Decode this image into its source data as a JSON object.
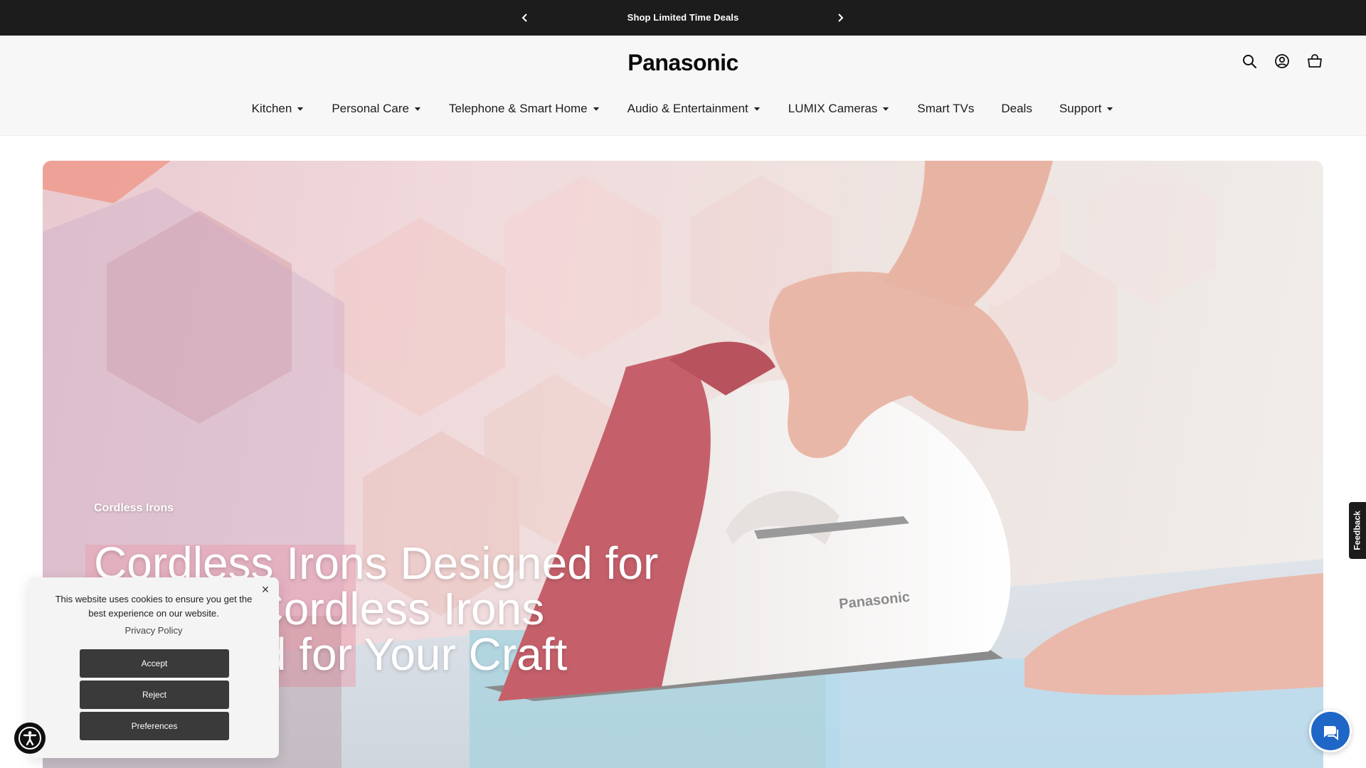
{
  "announcement": {
    "message": "Shop Limited Time Deals",
    "prev_icon": "chevron-left-icon",
    "next_icon": "chevron-right-icon"
  },
  "header": {
    "logo": "Panasonic",
    "icons": [
      "search-icon",
      "account-icon",
      "cart-icon"
    ]
  },
  "nav": {
    "items": [
      {
        "label": "Kitchen",
        "has_dropdown": true
      },
      {
        "label": "Personal Care",
        "has_dropdown": true
      },
      {
        "label": "Telephone & Smart Home",
        "has_dropdown": true
      },
      {
        "label": "Audio & Entertainment",
        "has_dropdown": true
      },
      {
        "label": "LUMIX Cameras",
        "has_dropdown": true
      },
      {
        "label": "Smart TVs",
        "has_dropdown": false
      },
      {
        "label": "Deals",
        "has_dropdown": false
      },
      {
        "label": "Support",
        "has_dropdown": true
      }
    ]
  },
  "hero": {
    "eyebrow": "Cordless Irons",
    "title": "Cordless Irons Designed for Perfect Cordless Irons Designed for Your Craft",
    "image_brand": "Panasonic"
  },
  "cookie": {
    "text": "This website uses cookies to ensure you get the best experience on our website.",
    "policy_link": "Privacy Policy",
    "accept": "Accept",
    "reject": "Reject",
    "preferences": "Preferences",
    "close": "×"
  },
  "feedback": {
    "label": "Feedback"
  },
  "colors": {
    "announcement_bg": "#1c1c1c",
    "header_bg": "#f7f7f7",
    "iron_red": "#c5606b",
    "chat_blue": "#1f67c7",
    "button_dark": "#3a3a3a"
  }
}
